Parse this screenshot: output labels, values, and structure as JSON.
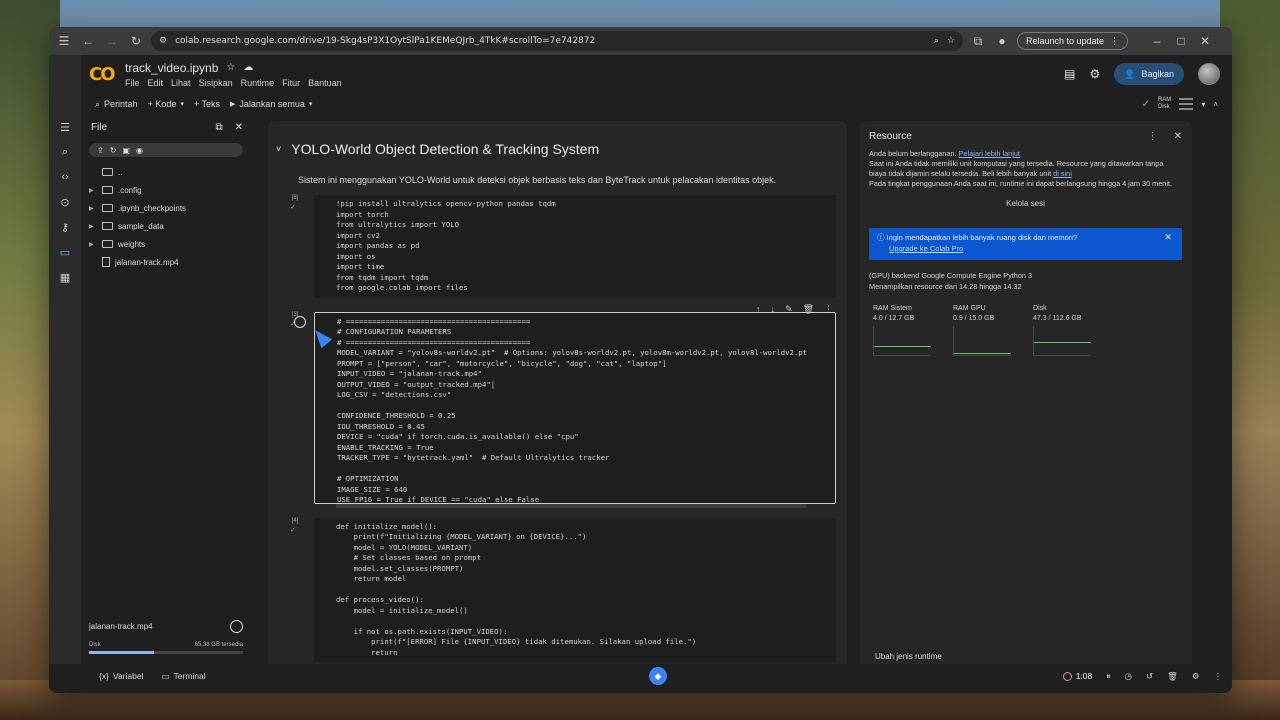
{
  "browser": {
    "url": "colab.research.google.com/drive/19-Skg4sP3X1OytSlPa1KEMeQJrb_4TkK#scrollTo=7e742872",
    "relaunch_label": "Relaunch to update"
  },
  "notebook": {
    "title": "track_video.ipynb",
    "menu": [
      "File",
      "Edit",
      "Lihat",
      "Sisipkan",
      "Runtime",
      "Fitur",
      "Bantuan"
    ],
    "share_label": "Bagikan"
  },
  "toolbar": {
    "perintah": "Perintah",
    "kode": "+ Kode",
    "teks": "+ Teks",
    "jalankan": "Jalankan semua",
    "ram_label": "RAM",
    "disk_label": "Disk"
  },
  "file_panel": {
    "title": "File",
    "items": [
      {
        "label": "..",
        "type": "folder",
        "expandable": false
      },
      {
        "label": ".config",
        "type": "folder",
        "expandable": true
      },
      {
        "label": ".ipynb_checkpoints",
        "type": "folder",
        "expandable": true
      },
      {
        "label": "sample_data",
        "type": "folder",
        "expandable": true
      },
      {
        "label": "weights",
        "type": "folder",
        "expandable": true
      },
      {
        "label": "jalanan-track.mp4",
        "type": "file",
        "expandable": false
      }
    ],
    "upload_file": "jalanan-track.mp4",
    "disk_label": "Disk",
    "disk_value": "65.38 GB tersedia",
    "disk_fraction": 0.42
  },
  "cells": {
    "heading": "YOLO-World Object Detection & Tracking System",
    "description": "Sistem ini menggunakan YOLO-World untuk deteksi objek berbasis teks dan ByteTrack untuk pelacakan identitas objek.",
    "cell1_count": "[8]",
    "cell1_code": "!pip install ultralytics opencv-python pandas tqdm\nimport torch\nfrom ultralytics import YOLO\nimport cv2\nimport pandas as pd\nimport os\nimport time\nfrom tqdm import tqdm\nfrom google.colab import files",
    "cell2_count": "[3]",
    "cell2_code": "# ==========================================\n# CONFIGURATION PARAMETERS\n# ==========================================\nMODEL_VARIANT = \"yolov8s-worldv2.pt\"  # Options: yolov8s-worldv2.pt, yolov8m-worldv2.pt, yolov8l-worldv2.pt\nPROMPT = [\"person\", \"car\", \"motorcycle\", \"bicycle\", \"dog\", \"cat\", \"laptop\"]\nINPUT_VIDEO = \"jalanan-track.mp4\"\nOUTPUT_VIDEO = \"output_tracked.mp4\"|\nLOG_CSV = \"detections.csv\"\n\nCONFIDENCE_THRESHOLD = 0.25\nIOU_THRESHOLD = 0.45\nDEVICE = \"cuda\" if torch.cuda.is_available() else \"cpu\"\nENABLE_TRACKING = True\nTRACKER_TYPE = \"bytetrack.yaml\"  # Default Ultralytics tracker\n\n# OPTIMIZATION\nIMAGE_SIZE = 640\nUSE_FP16 = True if DEVICE == \"cuda\" else False",
    "cell3_count": "[4]",
    "cell3_code": "def initialize_model():\n    print(f\"Initializing {MODEL_VARIANT} on {DEVICE}...\")\n    model = YOLO(MODEL_VARIANT)\n    # Set classes based on prompt\n    model.set_classes(PROMPT)\n    return model\n\ndef process_video():\n    model = initialize_model()\n\n    if not os.path.exists(INPUT_VIDEO):\n        print(f\"[ERROR] File {INPUT_VIDEO} tidak ditemukan. Silakan upload file.\")\n        return"
  },
  "resource": {
    "title": "Resource",
    "line1": "Anda belum berlangganan.",
    "line1_link": "Pelajari lebih lanjut",
    "line2": "Saat ini Anda tidak memiliki unit komputasi yang tersedia. Resource yang ditawarkan tanpa biaya tidak dijamin selalu tersedia. Beli lebih banyak unit",
    "line2_link": "di sini",
    "line3": "Pada tingkat penggunaan Anda saat ini, runtime ini dapat berlangsung hingga 4 jam 30 menit.",
    "manage": "Kelola sesi",
    "upgrade_text": "Ingin mendapatkan lebih banyak ruang disk dan memori?",
    "upgrade_link": "Upgrade ke Colab Pro",
    "backend": "(GPU) backend Google Compute Engine Python 3",
    "showing": "Menampilkan resource dari 14.28 hingga 14.32",
    "metrics": [
      {
        "name": "RAM Sistem",
        "value": "4.0 / 12.7 GB"
      },
      {
        "name": "RAM GPU",
        "value": "0.9 / 15.0 GB"
      },
      {
        "name": "Disk",
        "value": "47.3 / 112.6 GB"
      }
    ],
    "change_runtime": "Ubah jenis runtime"
  },
  "status": {
    "variables": "Variabel",
    "terminal": "Terminal",
    "timer": "1:08"
  }
}
